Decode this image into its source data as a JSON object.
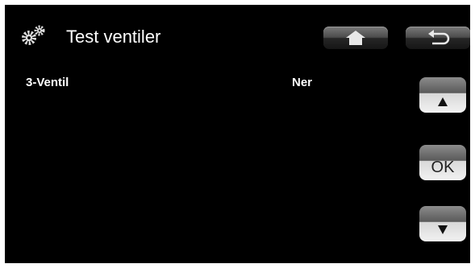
{
  "header": {
    "title": "Test ventiler",
    "settings_icon": "gears-icon",
    "home_icon": "home-icon",
    "back_icon": "back-arrow-icon"
  },
  "rows": [
    {
      "label": "3-Ventil",
      "value": "Ner"
    }
  ],
  "nav": {
    "up_icon": "triangle-up-icon",
    "ok_label": "OK",
    "down_icon": "triangle-down-icon"
  }
}
